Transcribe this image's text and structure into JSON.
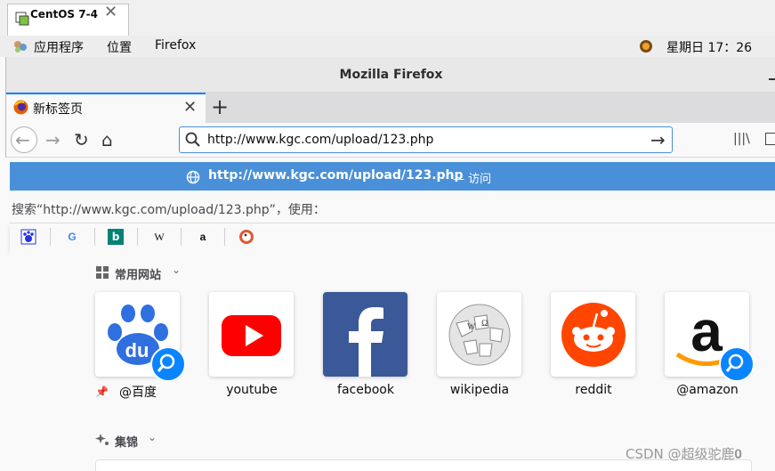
{
  "vm": {
    "tab_title": "CentOS 7-4",
    "close": "✕"
  },
  "gnome": {
    "apps": "应用程序",
    "places": "位置",
    "firefox": "Firefox",
    "clock": "星期日 17：26"
  },
  "window": {
    "title": "Mozilla Firefox"
  },
  "tabs": [
    {
      "label": "新标签页",
      "close": "✕"
    }
  ],
  "newtab": "+",
  "nav": {
    "back": "←",
    "forward": "→",
    "reload": "↻",
    "home": "⌂"
  },
  "urlbar": {
    "value": "http://www.kgc.com/upload/123.php",
    "go": "→"
  },
  "library": "|||\\",
  "suggestion": {
    "url": "http://www.kgc.com/upload/123.php",
    "action": "— 访问"
  },
  "search_line": "搜索“http://www.kgc.com/upload/123.php”，使用：",
  "bookmarks": [
    "baidu-icon",
    "google-icon",
    "bing-icon",
    "wikipedia-icon",
    "amazon-icon",
    "duckduckgo-icon"
  ],
  "top_sites": {
    "heading": "常用网站",
    "tiles": [
      {
        "label": "@百度",
        "icon": "baidu-icon"
      },
      {
        "label": "youtube",
        "icon": "youtube-icon"
      },
      {
        "label": "facebook",
        "icon": "facebook-icon"
      },
      {
        "label": "wikipedia",
        "icon": "wikipedia-icon"
      },
      {
        "label": "reddit",
        "icon": "reddit-icon"
      },
      {
        "label": "@amazon",
        "icon": "amazon-icon"
      }
    ]
  },
  "highlights": {
    "heading": "集锦"
  },
  "watermark": "CSDN @超级驼鹿𝟎",
  "colors": {
    "accent": "#4a90d9",
    "tab_accent": "#0a84ff"
  }
}
